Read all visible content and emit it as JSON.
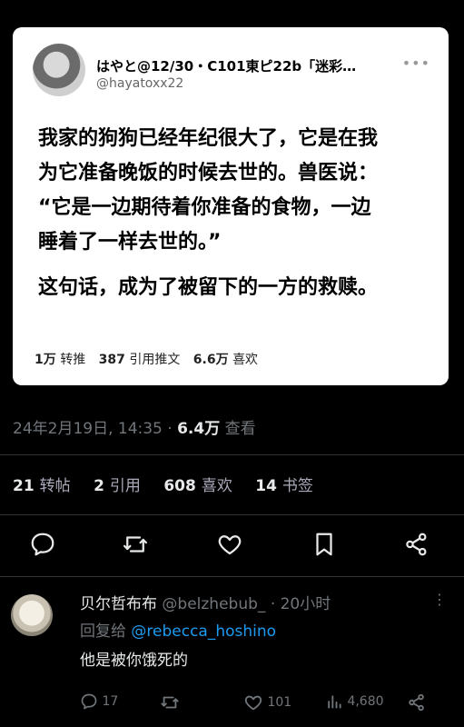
{
  "quoted": {
    "display_name": "はやと@12/30・C101東ピ22b「迷彩…",
    "handle": "@hayatoxx22",
    "lines": [
      "我家的狗狗已经年纪很大了，它是在我",
      "为它准备晚饭的时候去世的。兽医说：",
      "“它是一边期待着你准备的食物，一边",
      "睡着了一样去世的。”"
    ],
    "closing_line": "这句话，成为了被留下的一方的救赎。",
    "stats": {
      "retweets_value": "1万",
      "retweets_label": "转推",
      "quotes_value": "387",
      "quotes_label": "引用推文",
      "likes_value": "6.6万",
      "likes_label": "喜欢"
    }
  },
  "post": {
    "date": "24年2月19日, 14:35 ·",
    "views_value": "6.4万",
    "views_label": "查看",
    "counts": {
      "reposts_value": "21",
      "reposts_label": "转帖",
      "quotes_value": "2",
      "quotes_label": "引用",
      "likes_value": "608",
      "likes_label": "喜欢",
      "bookmarks_value": "14",
      "bookmarks_label": "书签"
    }
  },
  "reply": {
    "display_name": "贝尔哲布布",
    "handle": "@belzhebub_",
    "time": "· 20小时",
    "reply_to_prefix": "回复给",
    "reply_to_handle": "@rebecca_hoshino",
    "text": "他是被你饿死的",
    "reply_count": "17",
    "like_count": "101",
    "view_count": "4,680"
  },
  "colors": {
    "accent": "#1d9bf0",
    "muted": "#71767b",
    "bg": "#000000"
  }
}
